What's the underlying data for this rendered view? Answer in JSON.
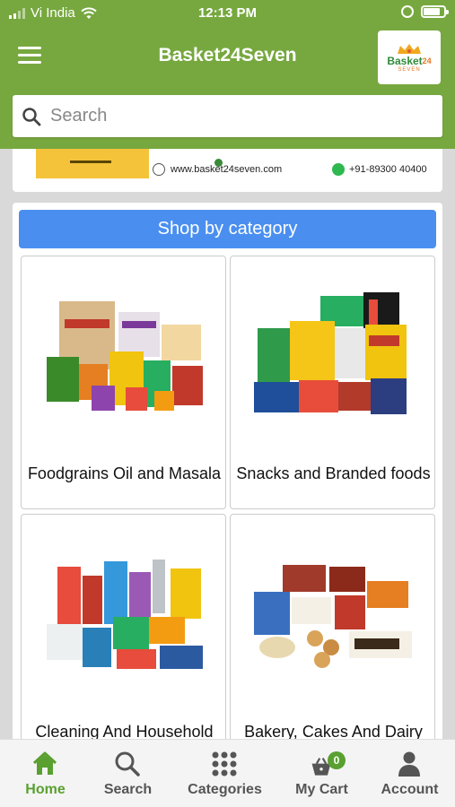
{
  "status_bar": {
    "carrier": "Vi India",
    "time": "12:13 PM"
  },
  "app_bar": {
    "title": "Basket24Seven",
    "logo_text": "Basket",
    "logo_superscript": "24",
    "logo_sub": "SEVEN",
    "brand_color": "#77a83f"
  },
  "search": {
    "placeholder": "Search"
  },
  "banner": {
    "website": "www.basket24seven.com",
    "phone": "+91-89300 40400"
  },
  "categories_section": {
    "header": "Shop by category",
    "header_color": "#4a8ff0",
    "items": [
      {
        "label": "Foodgrains Oil and Masala",
        "icon": "foodgrains-image"
      },
      {
        "label": "Snacks and Branded foods",
        "icon": "snacks-image"
      },
      {
        "label": "Cleaning And Household",
        "icon": "cleaning-image"
      },
      {
        "label": "Bakery, Cakes And Dairy",
        "icon": "bakery-image"
      }
    ]
  },
  "bottom_nav": {
    "items": [
      {
        "label": "Home",
        "icon": "home-icon",
        "active": true
      },
      {
        "label": "Search",
        "icon": "search-icon"
      },
      {
        "label": "Categories",
        "icon": "grid-icon"
      },
      {
        "label": "My Cart",
        "icon": "cart-icon",
        "badge": "0"
      },
      {
        "label": "Account",
        "icon": "person-icon"
      }
    ],
    "active_color": "#5aa031"
  }
}
